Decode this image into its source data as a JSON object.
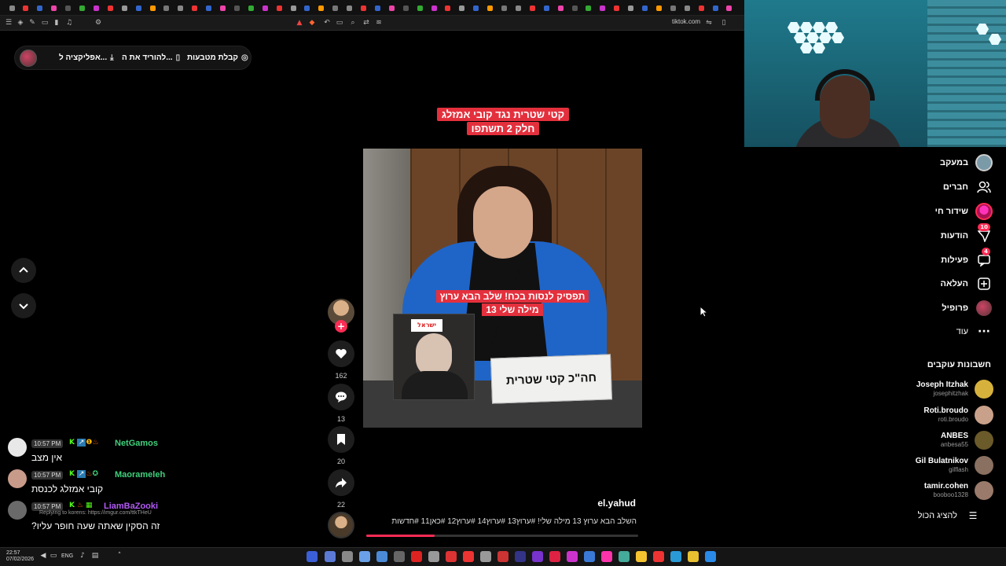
{
  "browser": {
    "url": "tiktok.com"
  },
  "header": {
    "coins_label": "קבלת מטבעות",
    "download_label": "להוריד את ה...",
    "app_label": "אפליקציה ל..."
  },
  "video": {
    "title_line1": "קטי שטרית נגד קובי אמזלג",
    "title_line2": "חלק 2 תשתפו",
    "overlay_line1": "תפסיק לנסות בכח! שלב הבא ערוץ",
    "overlay_line2": "13 מילה שלי",
    "nameplate": "חה\"כ קטי שטרית",
    "pip_sign": "ישראל",
    "author": "el.yahud",
    "caption": "השלב הבא ערוץ 13 מילה שלי! #ערוץ13 #ערוץ14 #ערוץ12 #כאן11 #חדשות",
    "progress": 0.25
  },
  "actions": {
    "likes": "162",
    "comments": "13",
    "saves": "20",
    "shares": "22"
  },
  "chat": [
    {
      "time": "10:57 PM",
      "user": "NetGamos",
      "user_color": "#3fd07b",
      "text": "אין מצב",
      "reply": ""
    },
    {
      "time": "10:57 PM",
      "user": "Maorameleh",
      "user_color": "#3fd07b",
      "text": "קובי אמזלג לכנסת",
      "reply": ""
    },
    {
      "time": "10:57 PM",
      "user": "LiamBaZooki",
      "user_color": "#b25af5",
      "text": "?זה הסקין שאתה שעה חופר עליו",
      "reply": "Replying to korens: https://imgur.com/ttkTHeU"
    }
  ],
  "sidebar": {
    "items": [
      {
        "label": "במעקב",
        "icon": "following-avatar-icon",
        "badge": ""
      },
      {
        "label": "חברים",
        "icon": "friends-icon",
        "badge": ""
      },
      {
        "label": "שידור חי",
        "icon": "live-icon",
        "badge": ""
      },
      {
        "label": "הודעות",
        "icon": "messages-icon",
        "badge": "10"
      },
      {
        "label": "פעילות",
        "icon": "activity-icon",
        "badge": "4"
      },
      {
        "label": "העלאה",
        "icon": "upload-icon",
        "badge": ""
      },
      {
        "label": "פרופיל",
        "icon": "profile-icon",
        "badge": ""
      },
      {
        "label": "עוד",
        "icon": "more-icon",
        "badge": ""
      }
    ],
    "following_heading": "חשבונות עוקבים",
    "accounts": [
      {
        "name": "Joseph Itzhak",
        "handle": "josephitzhak",
        "color": "#d6b23c"
      },
      {
        "name": "Roti.broudo",
        "handle": "roti.broudo",
        "color": "#c9a18a"
      },
      {
        "name": "ANBES",
        "handle": "anbesa55",
        "color": "#6b5a2a"
      },
      {
        "name": "Gil Bulatnikov",
        "handle": "gilflash",
        "color": "#8a7060"
      },
      {
        "name": "tamir.cohen",
        "handle": "booboo1328",
        "color": "#9a7a6a"
      }
    ],
    "show_all": "להציג הכול"
  },
  "taskbar": {
    "time": "22:57",
    "date": "07/02/2026",
    "lang": "ENG"
  }
}
